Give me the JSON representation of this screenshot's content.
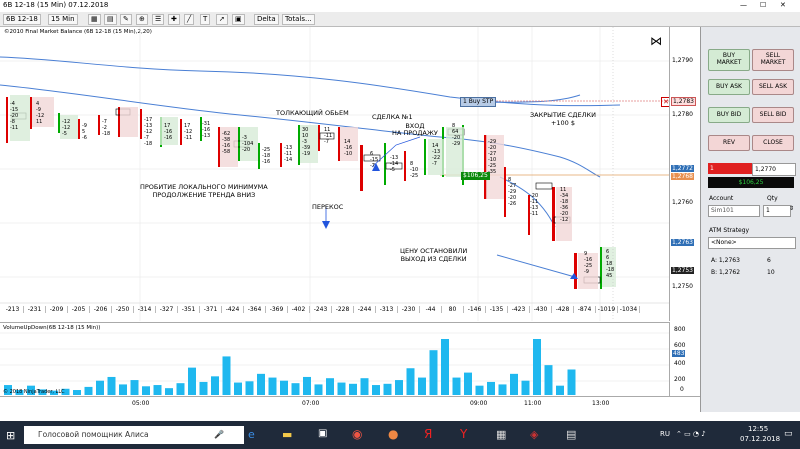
{
  "window": {
    "title": "6B 12-18 (15 Min)  07.12.2018"
  },
  "toolbar": {
    "instrument": "6B 12-18",
    "interval": "15 Min",
    "indicator": "Delta",
    "totals": "Totals..."
  },
  "chart": {
    "header": "©2010 Final Market Balance  (6B 12-18 (15 Min),2,20)",
    "price_ticks": [
      "1,2790",
      "1,2780",
      "1,2770",
      "1,2760",
      "1,2750"
    ],
    "labels": {
      "last_price": "1,2763",
      "ask_price": "1,2772",
      "bid_price": "1,2768",
      "current_price": "1,2753",
      "stp_price": "1,2783"
    },
    "buy_stp": "1  Buy STP",
    "pnl_tag": "$106,25",
    "annotations": {
      "pushing_volume": "ТОЛКАЮЩИЙ ОБЬЕМ",
      "deal1": "СДЕЛКА №1",
      "short_entry": "ВХОД\nНА ПРОДАЖУ",
      "closing": "ЗАКРЫТИЕ СДЕЛКИ\n+100 $",
      "breakout": "ПРОБИТИЕ ЛОКАЛЬНОГО МИНИМУМА\nПРОДОЛЖЕНИЕ ТРЕНДА ВНИЗ",
      "skew": "ПЕРЕКОС",
      "price_stopped": "ЦЕНУ ОСТАНОВИЛИ\nВЫХОД ИЗ СДЕЛКИ"
    },
    "deltas": [
      "-213",
      "-231",
      "-209",
      "-205",
      "-206",
      "-250",
      "-314",
      "-327",
      "-351",
      "-371",
      "-424",
      "-364",
      "-369",
      "-402",
      "-243",
      "-228",
      "-244",
      "-313",
      "-230",
      "-44",
      "80",
      "-146",
      "-135",
      "-423",
      "-430",
      "-428",
      "-874",
      "-1019",
      "-1034"
    ]
  },
  "volume": {
    "header": "VolumeUpDown(6B 12-18 (15 Min))",
    "ticks": [
      "800",
      "600",
      "400",
      "200",
      "0"
    ],
    "last": "483",
    "copyright": "© 2018 NinjaTrader, LLC",
    "bars": [
      160,
      80,
      150,
      90,
      70,
      100,
      80,
      130,
      230,
      290,
      170,
      240,
      140,
      160,
      110,
      190,
      440,
      210,
      300,
      620,
      200,
      220,
      340,
      280,
      230,
      190,
      290,
      170,
      270,
      200,
      180,
      270,
      160,
      180,
      240,
      430,
      280,
      720,
      920,
      280,
      360,
      150,
      210,
      170,
      340,
      230,
      940,
      480,
      150,
      410
    ]
  },
  "time_axis": [
    "05:00",
    "07:00",
    "09:00",
    "11:00",
    "13:00"
  ],
  "panel": {
    "buy_market": "BUY\nMARKET",
    "sell_market": "SELL\nMARKET",
    "buy_ask": "BUY ASK",
    "sell_ask": "SELL ASK",
    "buy_bid": "BUY BID",
    "sell_bid": "SELL BID",
    "rev": "REV",
    "close": "CLOSE",
    "position_qty": "1",
    "position_price": "1,2770",
    "pnl": "$106,25",
    "account_label": "Account",
    "qty_label": "Qty",
    "account": "Sim101",
    "qty": "1",
    "atm_label": "ATM Strategy",
    "atm_value": "<None>",
    "ask_label": "A: 1,2763",
    "ask_size": "6",
    "bid_label": "B: 1,2762",
    "bid_size": "10"
  },
  "taskbar": {
    "search": "Голосовой помощник Алиса",
    "lang": "RU",
    "time": "12:55",
    "date": "07.12.2018"
  }
}
